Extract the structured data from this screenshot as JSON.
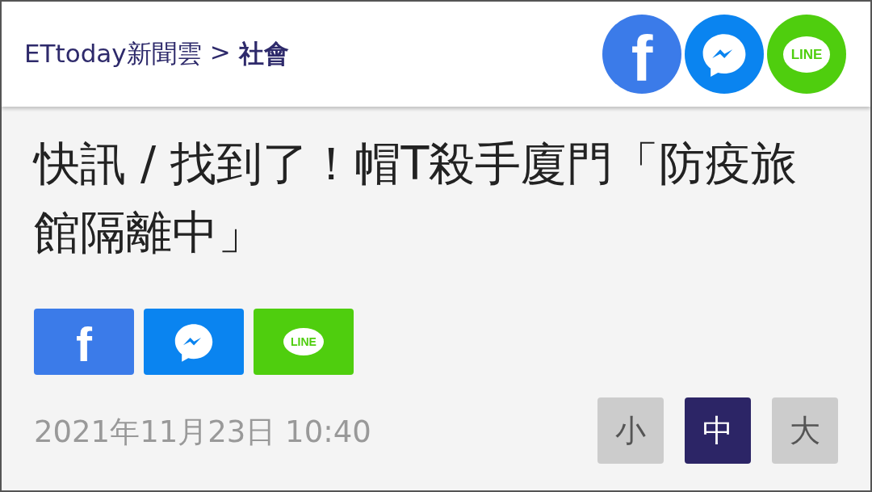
{
  "header": {
    "breadcrumb": [
      {
        "text": "ETtoday新聞雲",
        "bold": false
      },
      {
        "text": ">",
        "bold": false
      },
      {
        "text": "社會",
        "bold": true
      }
    ],
    "share": [
      {
        "kind": "facebook",
        "label": "f"
      },
      {
        "kind": "messenger"
      },
      {
        "kind": "line",
        "label": "LINE"
      }
    ]
  },
  "article": {
    "title": "快訊 / 找到了！帽T殺手廈門「防疫旅館隔離中」",
    "share": [
      {
        "kind": "facebook",
        "label": "f"
      },
      {
        "kind": "messenger"
      },
      {
        "kind": "line",
        "label": "LINE"
      }
    ],
    "date": "2021年11月23日 10:40",
    "font_sizes": [
      {
        "label": "小",
        "selected": false
      },
      {
        "label": "中",
        "selected": true
      },
      {
        "label": "大",
        "selected": false
      }
    ]
  }
}
